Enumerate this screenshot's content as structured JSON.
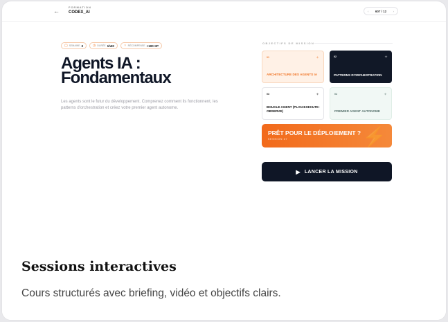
{
  "header": {
    "back_icon": "←",
    "kicker": "FORMATION",
    "brand": "CODEX_AI",
    "pager": {
      "prev": "‹",
      "current": "607 / 12",
      "next": "›"
    }
  },
  "stats": [
    {
      "icon": "calendar-icon",
      "glyph": "▢",
      "label": "SEMAINE",
      "value": "3"
    },
    {
      "icon": "clock-icon",
      "glyph": "◷",
      "label": "DURÉE",
      "value": "1h30"
    },
    {
      "icon": "trophy-icon",
      "glyph": "🏆",
      "label": "RÉCOMPENSE",
      "value": "+100 XP"
    }
  ],
  "course": {
    "title": "Agents IA : Fondamentaux",
    "description": "Les agents sont le futur du développement. Comprenez comment ils fonctionnent, les patterns d'orchestration et créez votre premier agent autonome."
  },
  "objectives": {
    "label": "OBJECTIFS DE MISSION",
    "items": [
      {
        "num": "01",
        "label": "ARCHITECTURE DES AGENTS IA"
      },
      {
        "num": "02",
        "label": "PATTERNS D'ORCHESTRATION"
      },
      {
        "num": "03",
        "label": "BOUCLE AGENT (PLAN-EXECUTE-OBSERVE)"
      },
      {
        "num": "04",
        "label": "PREMIER AGENT AUTONOME"
      }
    ]
  },
  "deploy": {
    "title": "PRÊT POUR LE DÉPLOIEMENT ?",
    "subtitle": "SESSION #7"
  },
  "launch": {
    "label": "LANCER LA MISSION"
  },
  "caption": {
    "title": "Sessions interactives",
    "subtitle": "Cours structurés avec briefing, vidéo et objectifs clairs."
  },
  "colors": {
    "accent": "#f26a1b",
    "dark": "#0f1626"
  }
}
